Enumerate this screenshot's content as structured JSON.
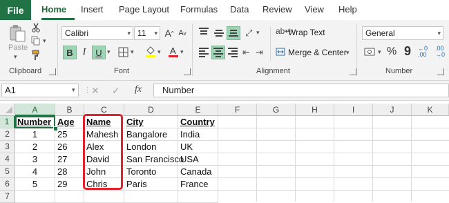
{
  "menu": {
    "file": "File",
    "tabs": [
      "Home",
      "Insert",
      "Page Layout",
      "Formulas",
      "Data",
      "Review",
      "View",
      "Help"
    ]
  },
  "ribbon": {
    "clipboard": {
      "paste": "Paste",
      "label": "Clipboard"
    },
    "font": {
      "family": "Calibri",
      "size": "11",
      "label": "Font",
      "bold": "B",
      "italic": "I",
      "underline": "U",
      "grow": "A",
      "shrink": "A"
    },
    "alignment": {
      "wrap_text": "Wrap Text",
      "merge_center": "Merge & Center",
      "label": "Alignment"
    },
    "number": {
      "format": "General",
      "percent": "%",
      "comma": "9",
      "label": "Number"
    }
  },
  "formula_bar": {
    "name_box": "A1",
    "cancel": "✕",
    "enter": "✓",
    "fx": "fx",
    "formula": "Number"
  },
  "grid": {
    "columns": [
      "A",
      "B",
      "C",
      "D",
      "E",
      "F",
      "G",
      "H",
      "I",
      "J",
      "K"
    ],
    "rows": [
      "1",
      "2",
      "3",
      "4",
      "5",
      "6",
      "7"
    ],
    "header": [
      "Number",
      "Age",
      "Name",
      "City",
      "Country"
    ],
    "data": [
      [
        "1",
        "25",
        "Mahesh",
        "Bangalore",
        "India"
      ],
      [
        "2",
        "26",
        "Alex",
        "London",
        "UK"
      ],
      [
        "3",
        "27",
        "David",
        "San Francisco",
        "USA"
      ],
      [
        "4",
        "28",
        "John",
        "Toronto",
        "Canada"
      ],
      [
        "5",
        "29",
        "Chris",
        "Paris",
        "France"
      ]
    ]
  },
  "colors": {
    "accent": "#217346",
    "highlight": "#e0222d",
    "fill_swatch": "#ffff00",
    "font_swatch": "#e0222d"
  }
}
